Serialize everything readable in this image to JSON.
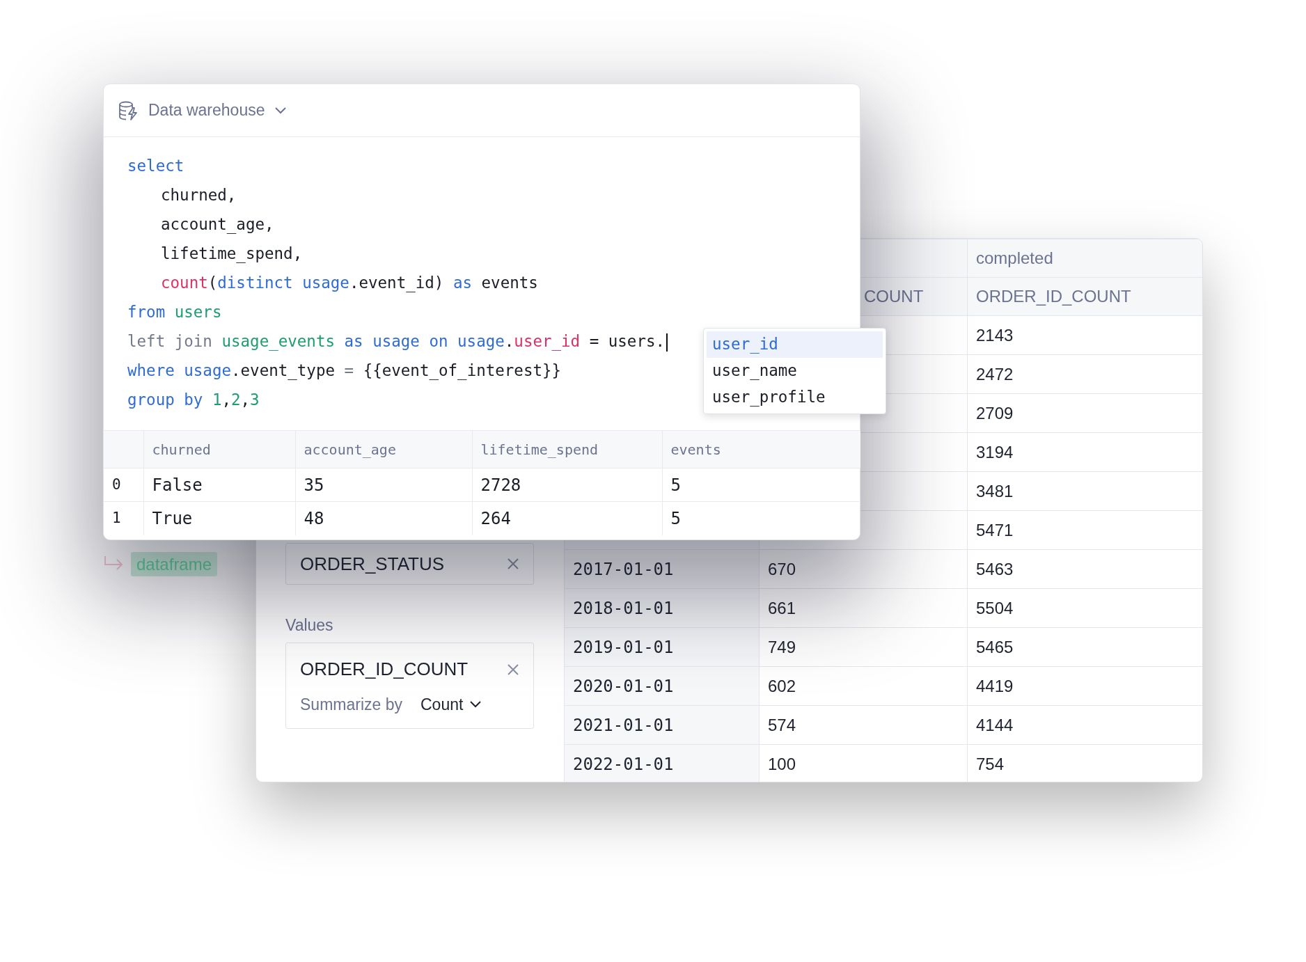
{
  "query_cell": {
    "source": {
      "label": "Data warehouse"
    },
    "code_lines": [
      {
        "indent": false,
        "cursor": false,
        "tokens": [
          {
            "text": "select",
            "kind": "keyword",
            "gap": false
          }
        ]
      },
      {
        "indent": true,
        "cursor": false,
        "tokens": [
          {
            "text": "churned,",
            "kind": "plain",
            "gap": false
          }
        ]
      },
      {
        "indent": true,
        "cursor": false,
        "tokens": [
          {
            "text": "account_age,",
            "kind": "plain",
            "gap": false
          }
        ]
      },
      {
        "indent": true,
        "cursor": false,
        "tokens": [
          {
            "text": "lifetime_spend,",
            "kind": "plain",
            "gap": false
          }
        ]
      },
      {
        "indent": true,
        "cursor": false,
        "tokens": [
          {
            "text": "count",
            "kind": "function",
            "gap": false
          },
          {
            "text": "(",
            "kind": "plain",
            "gap": false
          },
          {
            "text": "distinct",
            "kind": "keyword",
            "gap": false
          },
          {
            "text": "usage",
            "kind": "keyword",
            "gap": true
          },
          {
            "text": ".event_id)",
            "kind": "plain",
            "gap": false
          },
          {
            "text": "as",
            "kind": "keyword",
            "gap": true
          },
          {
            "text": "events",
            "kind": "plain",
            "gap": true
          }
        ]
      },
      {
        "indent": false,
        "cursor": false,
        "tokens": [
          {
            "text": "from",
            "kind": "keyword",
            "gap": false
          },
          {
            "text": "users",
            "kind": "table",
            "gap": true
          }
        ]
      },
      {
        "indent": false,
        "cursor": true,
        "tokens": [
          {
            "text": "left join",
            "kind": "muted",
            "gap": false
          },
          {
            "text": "usage_events",
            "kind": "table",
            "gap": true
          },
          {
            "text": "as",
            "kind": "keyword",
            "gap": true
          },
          {
            "text": "usage",
            "kind": "keyword",
            "gap": true
          },
          {
            "text": "on",
            "kind": "keyword",
            "gap": true
          },
          {
            "text": "usage",
            "kind": "keyword",
            "gap": true
          },
          {
            "text": ".",
            "kind": "plain",
            "gap": false
          },
          {
            "text": "user_id",
            "kind": "function",
            "gap": false
          },
          {
            "text": "=",
            "kind": "plain",
            "gap": true
          },
          {
            "text": "users.",
            "kind": "plain",
            "gap": true
          }
        ]
      },
      {
        "indent": false,
        "cursor": false,
        "tokens": [
          {
            "text": "where",
            "kind": "keyword",
            "gap": false
          },
          {
            "text": "usage",
            "kind": "keyword",
            "gap": true
          },
          {
            "text": ".event_type",
            "kind": "plain",
            "gap": false
          },
          {
            "text": "=",
            "kind": "muted",
            "gap": true
          },
          {
            "text": "{{event_of_interest}}",
            "kind": "plain",
            "gap": true
          }
        ]
      },
      {
        "indent": false,
        "cursor": false,
        "tokens": [
          {
            "text": "group by",
            "kind": "keyword",
            "gap": false
          },
          {
            "text": "1",
            "kind": "number",
            "gap": true
          },
          {
            "text": ",",
            "kind": "plain",
            "gap": false
          },
          {
            "text": "2",
            "kind": "number",
            "gap": false
          },
          {
            "text": ",",
            "kind": "plain",
            "gap": false
          },
          {
            "text": "3",
            "kind": "number",
            "gap": false
          }
        ]
      }
    ],
    "autocomplete": {
      "items": [
        {
          "label": "user_id",
          "selected": true
        },
        {
          "label": "user_name",
          "selected": false
        },
        {
          "label": "user_profile",
          "selected": false
        }
      ]
    },
    "results": {
      "columns": [
        "churned",
        "account_age",
        "lifetime_spend",
        "events"
      ],
      "rows": [
        {
          "index": "0",
          "cells": [
            "False",
            "35",
            "2728",
            "5"
          ]
        },
        {
          "index": "1",
          "cells": [
            "True",
            "48",
            "264",
            "5"
          ]
        }
      ]
    },
    "output_tag": "dataframe"
  },
  "pivot_panel": {
    "columns_field": {
      "label": "ORDER_STATUS"
    },
    "values_label": "Values",
    "values_field": {
      "label": "ORDER_ID_COUNT",
      "summarize_label": "Summarize by",
      "summarize_value": "Count"
    },
    "table": {
      "header_rows": [
        {
          "column_3": "completed"
        },
        {
          "column_2": "COUNT",
          "column_3": "ORDER_ID_COUNT"
        }
      ],
      "rows": [
        {
          "column_3": "2143"
        },
        {
          "column_3": "2472"
        },
        {
          "column_3": "2709"
        },
        {
          "column_3": "3194"
        },
        {
          "column_3": "3481"
        },
        {
          "column_3": "5471"
        },
        {
          "column_1": "2017-01-01",
          "column_2": "670",
          "column_3": "5463"
        },
        {
          "column_1": "2018-01-01",
          "column_2": "661",
          "column_3": "5504"
        },
        {
          "column_1": "2019-01-01",
          "column_2": "749",
          "column_3": "5465"
        },
        {
          "column_1": "2020-01-01",
          "column_2": "602",
          "column_3": "4419"
        },
        {
          "column_1": "2021-01-01",
          "column_2": "574",
          "column_3": "4144"
        },
        {
          "column_1": "2022-01-01",
          "column_2": "100",
          "column_3": "754"
        }
      ]
    }
  }
}
